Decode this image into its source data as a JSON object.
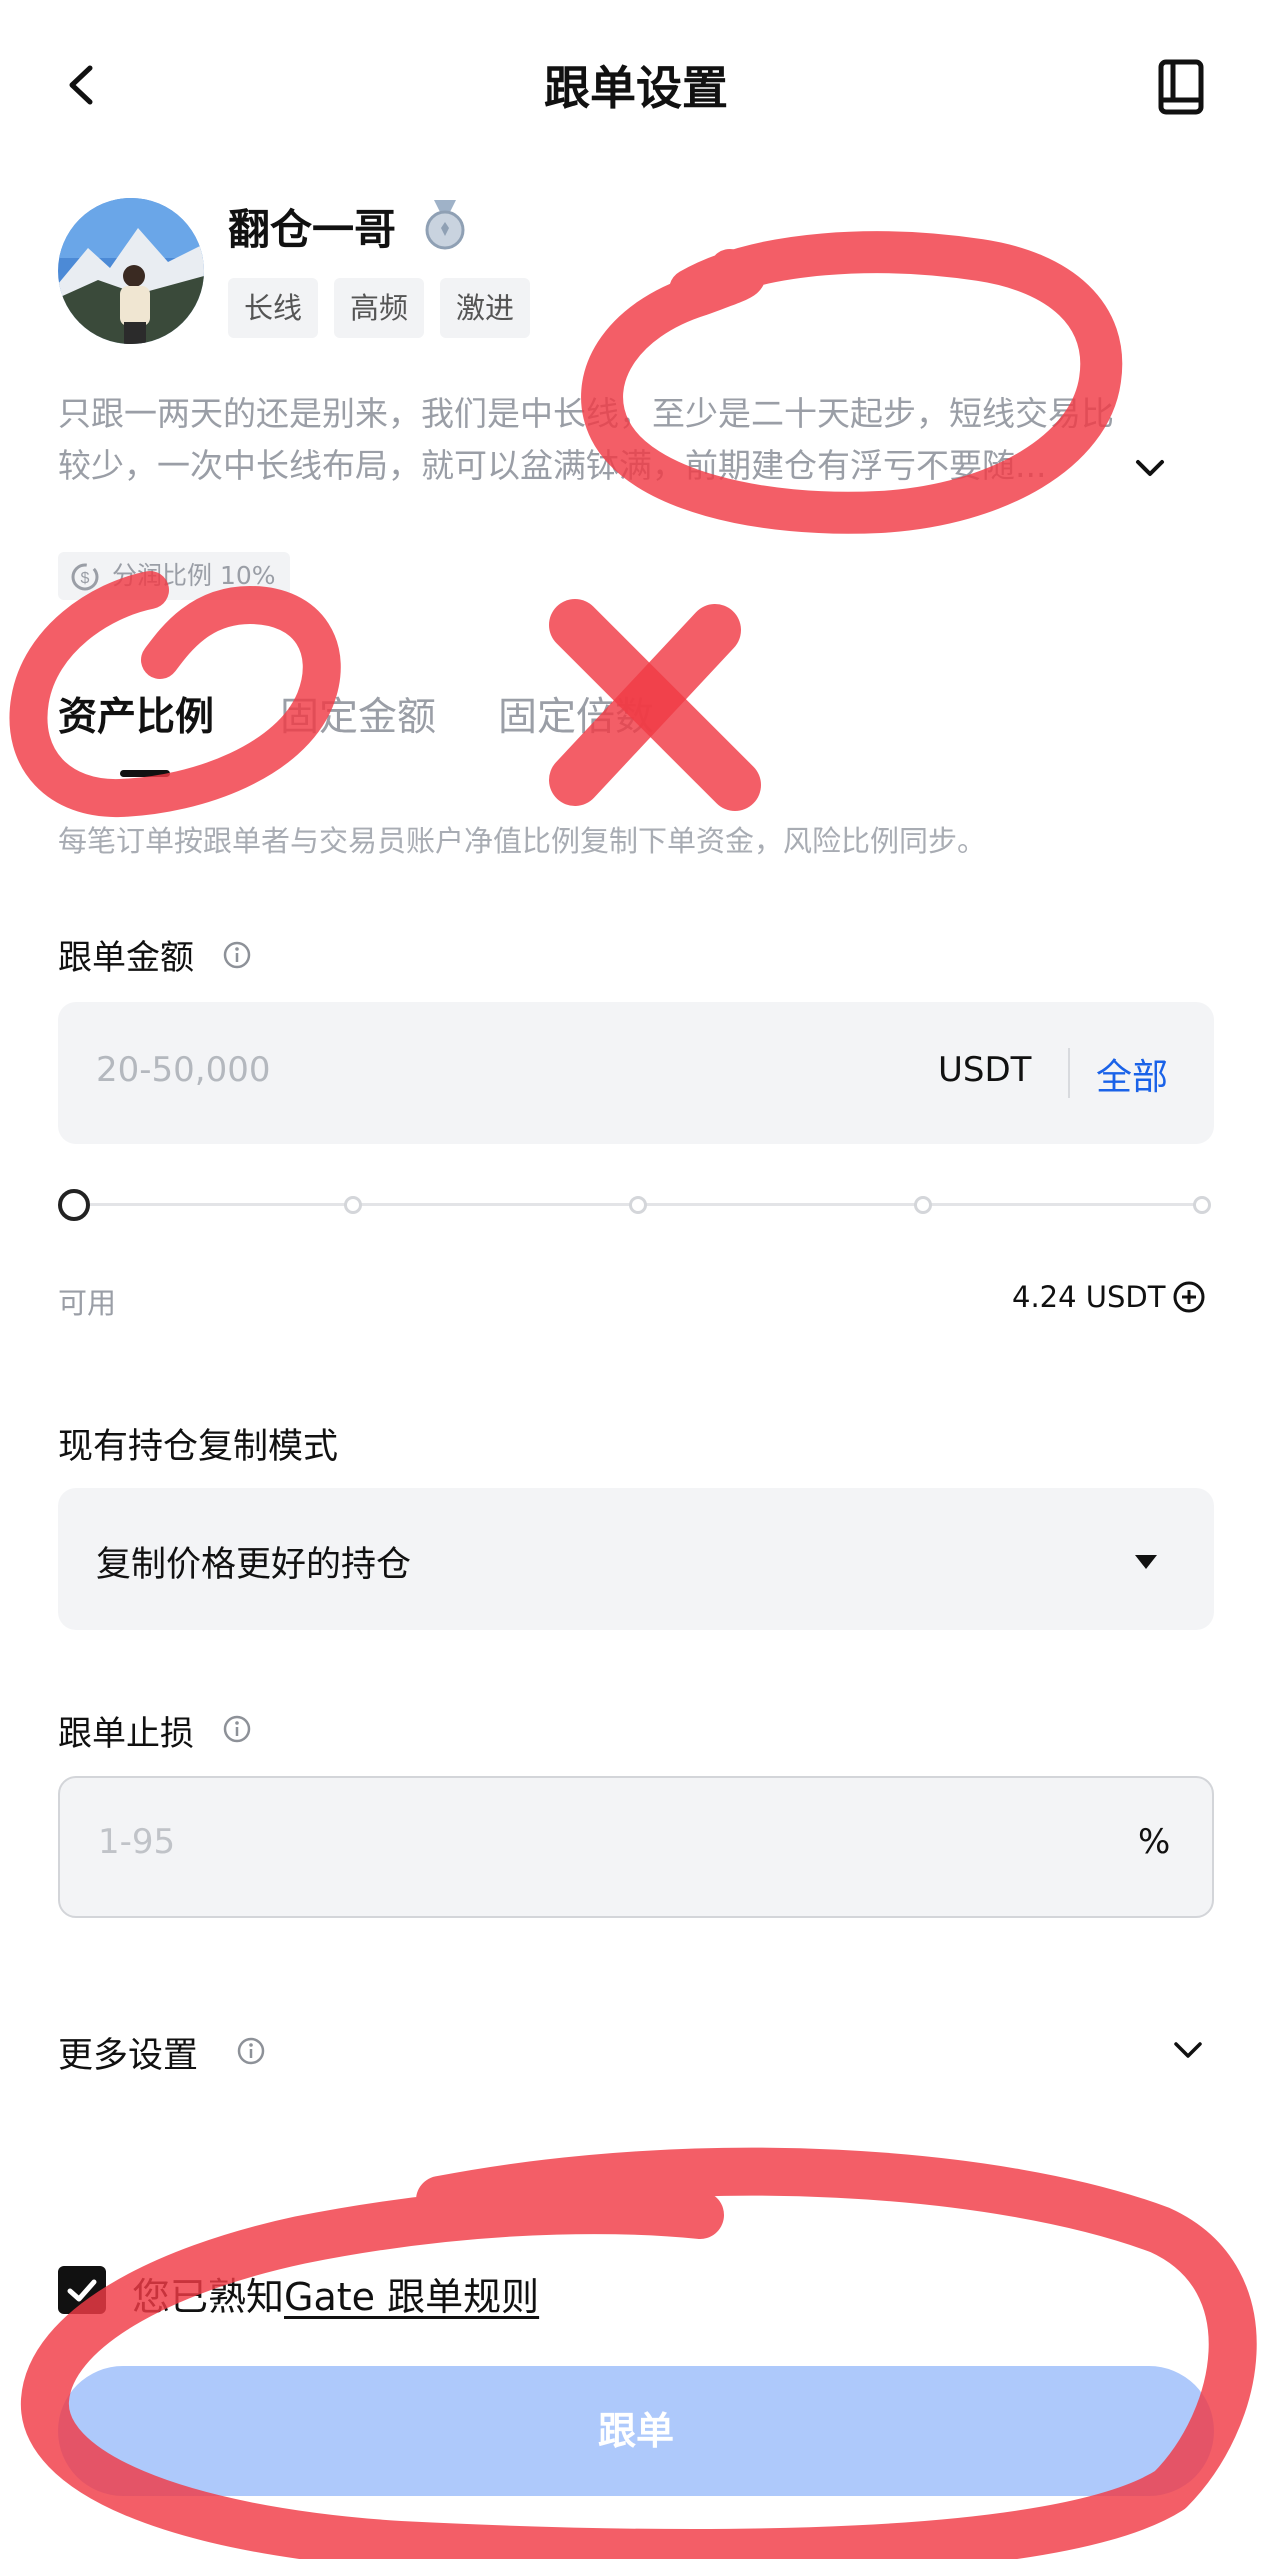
{
  "header": {
    "title": "跟单设置"
  },
  "trader": {
    "name": "翻仓一哥",
    "tags": [
      "长线",
      "高频",
      "激进"
    ],
    "bio_line1": "只跟一两天的还是别来，我们是中长线，至少是二十天起步，短线交易比",
    "bio_line2": "较少，一次中长线布局，就可以盆满钵满，前期建仓有浮亏不要随...",
    "profit_share": "分润比例 10%"
  },
  "tabs": {
    "items": [
      "资产比例",
      "固定金额",
      "固定倍数"
    ],
    "active": "资产比例",
    "description": "每笔订单按跟单者与交易员账户净值比例复制下单资金，风险比例同步。"
  },
  "amount": {
    "label": "跟单金额",
    "placeholder": "20-50,000",
    "unit": "USDT",
    "all_label": "全部",
    "slider_percent": 0,
    "available_label": "可用",
    "available_value": "4.24 USDT"
  },
  "copy_mode": {
    "label": "现有持仓复制模式",
    "selected": "复制价格更好的持仓"
  },
  "stop_loss": {
    "label": "跟单止损",
    "placeholder": "1-95",
    "unit": "%"
  },
  "more_settings": {
    "label": "更多设置"
  },
  "agreement": {
    "checked": true,
    "text": "您已熟知",
    "link": "Gate 跟单规则"
  },
  "submit": {
    "label": "跟单"
  },
  "colors": {
    "accent_blue": "#1a62e8",
    "button_disabled": "#aec9fb",
    "annotation_red": "#f03a45"
  },
  "icons": {
    "back": "chevron-left-icon",
    "guide": "book-icon",
    "medal": "medal-icon",
    "info": "info-icon",
    "add": "plus-circle-icon",
    "dropdown": "caret-down-icon",
    "expand": "chevron-down-icon",
    "check": "checkmark-icon"
  }
}
